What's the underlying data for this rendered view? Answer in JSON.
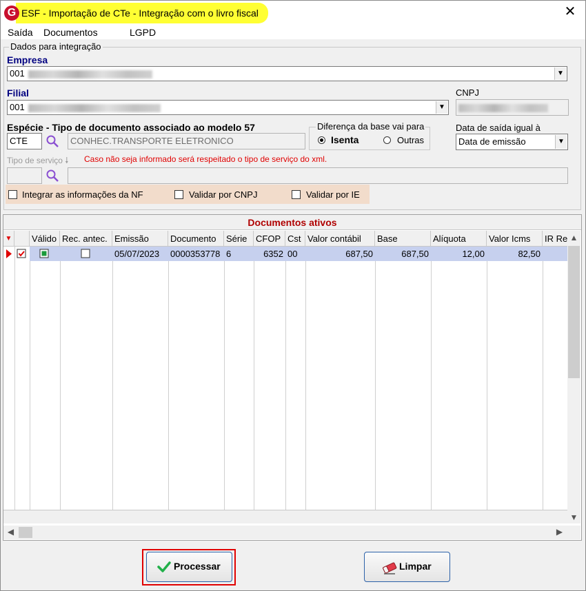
{
  "window": {
    "app_logo": "G",
    "title": "ESF - Importação de CTe - Integração com o livro fiscal",
    "close_glyph": "✕"
  },
  "menu": {
    "items": [
      "Saída",
      "Documentos",
      "LGPD"
    ]
  },
  "form": {
    "group_title": "Dados para integração",
    "empresa": {
      "label": "Empresa",
      "value": "001"
    },
    "filial": {
      "label": "Filial",
      "value": "001"
    },
    "cnpj": {
      "label": "CNPJ"
    },
    "especie": {
      "label": "Espécie - Tipo de documento associado ao modelo 57",
      "code": "CTE",
      "description": "CONHEC.TRANSPORTE ELETRONICO"
    },
    "diferenca": {
      "legend": "Diferença da base vai para",
      "options": [
        "Isenta",
        "Outras"
      ],
      "selected": "Isenta"
    },
    "data_saida": {
      "label": "Data de saída igual à",
      "value": "Data de emissão"
    },
    "tipo_servico": {
      "label": "Tipo de serviço",
      "hint": "Caso não seja informado será respeitado o tipo de serviço do xml."
    },
    "checks": [
      {
        "label": "Integrar as informações da NF",
        "checked": false
      },
      {
        "label": "Validar por CNPJ",
        "checked": false
      },
      {
        "label": "Validar por IE",
        "checked": false
      }
    ]
  },
  "grid": {
    "title": "Documentos ativos",
    "columns": [
      "",
      "",
      "Válido",
      "Rec. antec.",
      "Emissão",
      "Documento",
      "Série",
      "CFOP",
      "Cst",
      "Valor contábil",
      "Base",
      "Alíquota",
      "Valor Icms",
      "IR Re"
    ],
    "rows": [
      {
        "selected": true,
        "valido": true,
        "rec_antec": false,
        "emissao": "05/07/2023",
        "documento": "0000353778",
        "serie": "6",
        "cfop": "6352",
        "cst": "00",
        "valor_contabil": "687,50",
        "base": "687,50",
        "aliquota": "12,00",
        "valor_icms": "82,50"
      }
    ]
  },
  "buttons": {
    "processar": "Processar",
    "limpar": "Limpar"
  },
  "colors": {
    "title_highlight": "#ffff33",
    "label_blue": "#000080",
    "hint_red": "#e00000",
    "grid_title_red": "#b00000",
    "selected_row": "#c6d0ee",
    "checkbar_bg": "#f2dccb",
    "highlight_box": "#e00000"
  }
}
